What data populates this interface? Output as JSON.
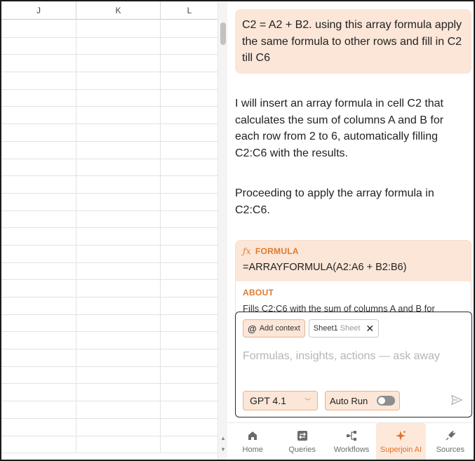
{
  "sheet": {
    "columns": [
      "J",
      "K",
      "L"
    ],
    "row_count": 25
  },
  "chat": {
    "user_message": "C2 = A2 + B2. using this array formula apply the same formula to other rows and fill in C2 till C6",
    "ai_paragraph_1": "I will insert an array formula in cell C2 that calculates the sum of columns A and B for each row from 2 to 6, automatically filling C2:C6 with the results.",
    "ai_paragraph_2": "Proceeding to apply the array formula in C2:C6."
  },
  "formula_card": {
    "label": "FORMULA",
    "formula": "=ARRAYFORMULA(A2:A6 + B2:B6)",
    "about_label": "ABOUT",
    "about_text": "Fills C2:C6 with the sum of columns A and B for"
  },
  "composer": {
    "add_context_label": "Add context",
    "sheet_chip_name": "Sheet1",
    "sheet_chip_sub": "Sheet",
    "placeholder": "Formulas, insights, actions — ask away",
    "model": "GPT 4.1",
    "autorun_label": "Auto Run",
    "autorun_enabled": false
  },
  "tabs": [
    {
      "label": "Home",
      "icon": "home-icon"
    },
    {
      "label": "Queries",
      "icon": "queries-icon"
    },
    {
      "label": "Workflows",
      "icon": "workflows-icon"
    },
    {
      "label": "Superjoin AI",
      "icon": "sparkle-icon",
      "active": true
    },
    {
      "label": "Sources",
      "icon": "plug-icon"
    }
  ],
  "colors": {
    "accent": "#e0702a",
    "accent_bg": "#fbe6d8"
  }
}
